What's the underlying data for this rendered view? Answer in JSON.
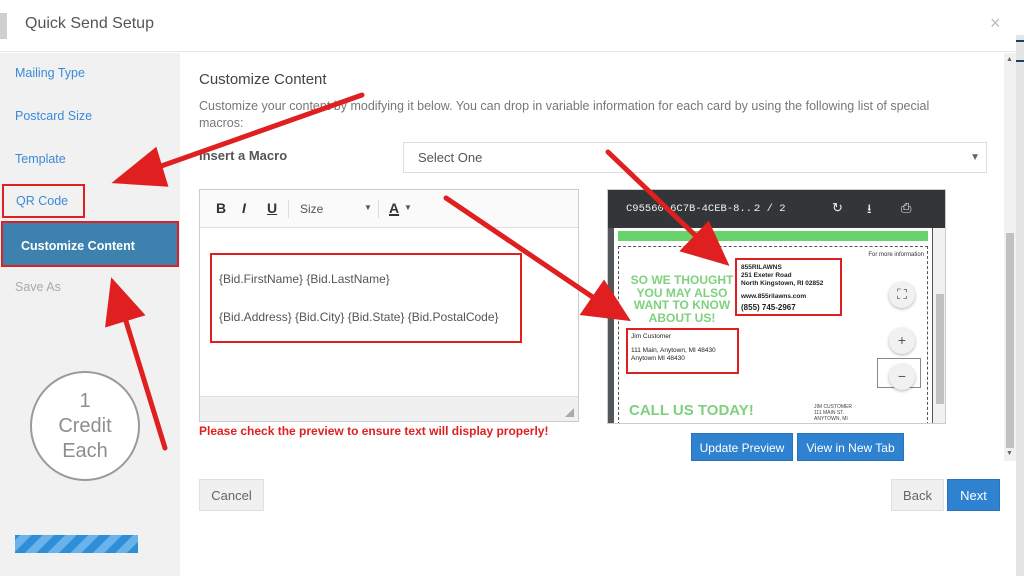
{
  "header": {
    "title": "Quick Send Setup",
    "close": "×"
  },
  "sidebar": {
    "items": [
      {
        "label": "Mailing Type"
      },
      {
        "label": "Postcard Size"
      },
      {
        "label": "Template"
      },
      {
        "label": "QR Code"
      },
      {
        "label": "Customize Content"
      },
      {
        "label": "Save As"
      }
    ],
    "credit": {
      "count": "1",
      "line1": "Credit",
      "line2": "Each"
    },
    "progress_percent": 100
  },
  "main": {
    "title": "Customize Content",
    "description": "Customize your content by modifying it below. You can drop in variable information for each card by using the following list of special macros:",
    "macro_label": "Insert a Macro",
    "macro_select_value": "Select One",
    "editor": {
      "toolbar": {
        "bold": "B",
        "italic": "I",
        "underline": "U",
        "size": "Size",
        "font_color": "A"
      },
      "line1": "{Bid.FirstName} {Bid.LastName}",
      "line2": "{Bid.Address} {Bid.City} {Bid.State} {Bid.PostalCode}"
    },
    "warning": "Please check the preview to ensure text will display properly!",
    "preview": {
      "file_name": "C95560",
      "file_name_rest": "-6C7B-4CEB-8...",
      "page": "2 / 2",
      "more_info": "For more information",
      "teaser": "SO WE THOUGHT YOU MAY ALSO WANT TO KNOW ABOUT US!",
      "sender": {
        "company": "855RILAWNS",
        "street": "251 Exeter Road",
        "city": "North Kingstown, RI 02852",
        "web": "www.855rilawns.com",
        "phone": "(855) 745-2967"
      },
      "recipient": {
        "name": "Jim Customer",
        "street": "111 Main, Anytown, MI  48430",
        "city": "Anytown MI 48430"
      },
      "call": "CALL US TODAY!",
      "recipient2": [
        "JIM CUSTOMER",
        "111 MAIN ST.",
        "ANYTOWN, MI"
      ]
    },
    "buttons": {
      "update_preview": "Update Preview",
      "view_new_tab": "View in New Tab",
      "cancel": "Cancel",
      "back": "Back",
      "next": "Next"
    }
  },
  "colors": {
    "accent": "#3d82af",
    "primary_button": "#2e82d0",
    "annotation": "#e02020",
    "warning_text": "#e02020"
  }
}
